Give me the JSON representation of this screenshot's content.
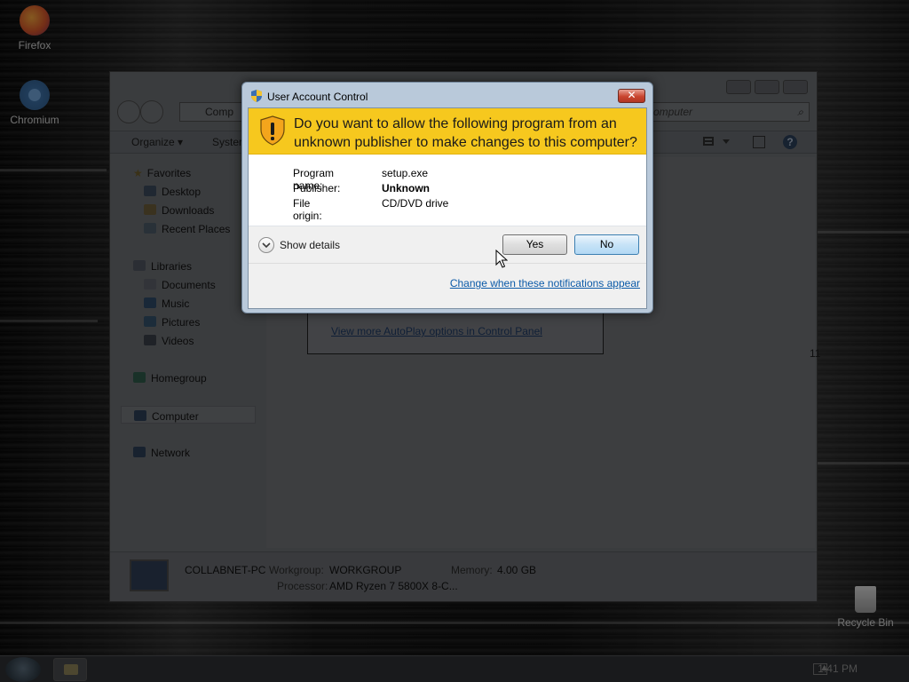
{
  "desktop": {
    "icons": [
      {
        "label": "Firefox",
        "icon": "firefox-icon"
      },
      {
        "label": "Chromium",
        "icon": "chromium-icon"
      },
      {
        "label": "Recycle Bin",
        "icon": "recycle-bin-icon"
      }
    ]
  },
  "explorer": {
    "address_text": "Comp",
    "search_placeholder": "omputer",
    "toolbar": {
      "organize": "Organize ▾",
      "system": "Syster"
    },
    "sidebar": {
      "favorites": "Favorites",
      "desktop": "Desktop",
      "downloads": "Downloads",
      "recent_places": "Recent Places",
      "libraries": "Libraries",
      "documents": "Documents",
      "music": "Music",
      "pictures": "Pictures",
      "videos": "Videos",
      "homegroup": "Homegroup",
      "computer": "Computer",
      "network": "Network"
    },
    "content": {
      "autoplay_link": "View more AutoPlay options in Control Panel",
      "partial_number": "11"
    },
    "details": {
      "pc_name": "COLLABNET-PC",
      "workgroup_label": "Workgroup:",
      "workgroup_value": "WORKGROUP",
      "memory_label": "Memory:",
      "memory_value": "4.00 GB",
      "processor_label": "Processor:",
      "processor_value": "AMD Ryzen 7 5800X 8-C..."
    }
  },
  "taskbar": {
    "clock": "1:41 PM",
    "tray_arrow": "▲"
  },
  "uac": {
    "title": "User Account Control",
    "close_label": "✕",
    "question": "Do you want to allow the following program from an unknown publisher to make changes to this computer?",
    "program_name_label": "Program name:",
    "program_name_value": "setup.exe",
    "publisher_label": "Publisher:",
    "publisher_value": "Unknown",
    "file_origin_label": "File origin:",
    "file_origin_value": "CD/DVD drive",
    "show_details": "Show details",
    "yes_label": "Yes",
    "no_label": "No",
    "change_link": "Change when these notifications appear"
  },
  "colors": {
    "uac_header": "#f6c81e",
    "uac_frame": "#b9c9da",
    "link": "#0b5aa8"
  }
}
